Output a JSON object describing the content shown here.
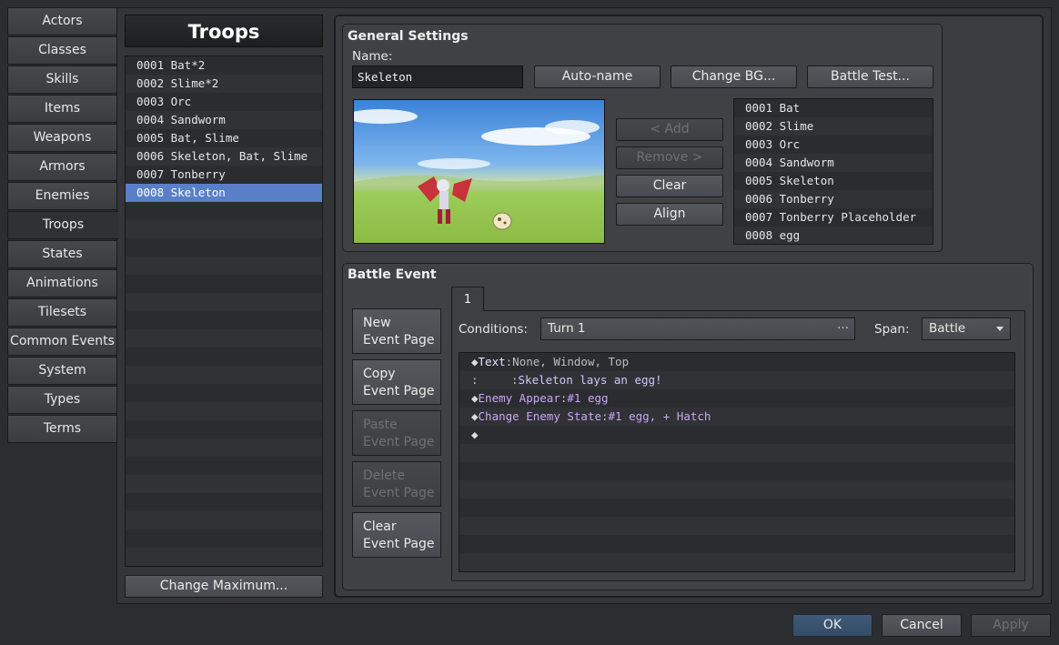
{
  "tabs": [
    {
      "label": "Actors",
      "active": false
    },
    {
      "label": "Classes",
      "active": false
    },
    {
      "label": "Skills",
      "active": false
    },
    {
      "label": "Items",
      "active": false
    },
    {
      "label": "Weapons",
      "active": false
    },
    {
      "label": "Armors",
      "active": false
    },
    {
      "label": "Enemies",
      "active": false
    },
    {
      "label": "Troops",
      "active": true
    },
    {
      "label": "States",
      "active": false
    },
    {
      "label": "Animations",
      "active": false
    },
    {
      "label": "Tilesets",
      "active": false
    },
    {
      "label": "Common Events",
      "active": false
    },
    {
      "label": "System",
      "active": false
    },
    {
      "label": "Types",
      "active": false
    },
    {
      "label": "Terms",
      "active": false
    }
  ],
  "troops": {
    "title": "Troops",
    "items": [
      "0001 Bat*2",
      "0002 Slime*2",
      "0003 Orc",
      "0004 Sandworm",
      "0005 Bat, Slime",
      "0006 Skeleton, Bat, Slime",
      "0007 Tonberry",
      "0008 Skeleton"
    ],
    "selected_index": 7,
    "change_max_label": "Change Maximum..."
  },
  "general": {
    "title": "General Settings",
    "name_label": "Name:",
    "name_value": "Skeleton",
    "auto_name_label": "Auto-name",
    "change_bg_label": "Change BG...",
    "battle_test_label": "Battle Test...",
    "add_label": "< Add",
    "remove_label": "Remove >",
    "clear_label": "Clear",
    "align_label": "Align",
    "enemies": [
      "0001 Bat",
      "0002 Slime",
      "0003 Orc",
      "0004 Sandworm",
      "0005 Skeleton",
      "0006 Tonberry",
      "0007 Tonberry Placeholder",
      "0008 egg"
    ]
  },
  "battle_event": {
    "title": "Battle Event",
    "page_tab": "1",
    "new_page": [
      "New",
      "Event Page"
    ],
    "copy_page": [
      "Copy",
      "Event Page"
    ],
    "paste_page": [
      "Paste",
      "Event Page"
    ],
    "delete_page": [
      "Delete",
      "Event Page"
    ],
    "clear_page": [
      "Clear",
      "Event Page"
    ],
    "conditions_label": "Conditions:",
    "conditions_value": "Turn 1",
    "conditions_ellipsis": "···",
    "span_label": "Span:",
    "span_value": "Battle",
    "commands": {
      "c1_name": "Text",
      "c1_args": "None, Window, Top",
      "c2_prefix": ":",
      "c2_args": "Skeleton lays an egg!",
      "c3_name": "Enemy Appear",
      "c3_args": "#1 egg",
      "c4_name": "Change Enemy State",
      "c4_args": "#1 egg, + Hatch",
      "diamond": "◆",
      "sep": ":"
    }
  },
  "footer": {
    "ok_label": "OK",
    "cancel_label": "Cancel",
    "apply_label": "Apply"
  }
}
